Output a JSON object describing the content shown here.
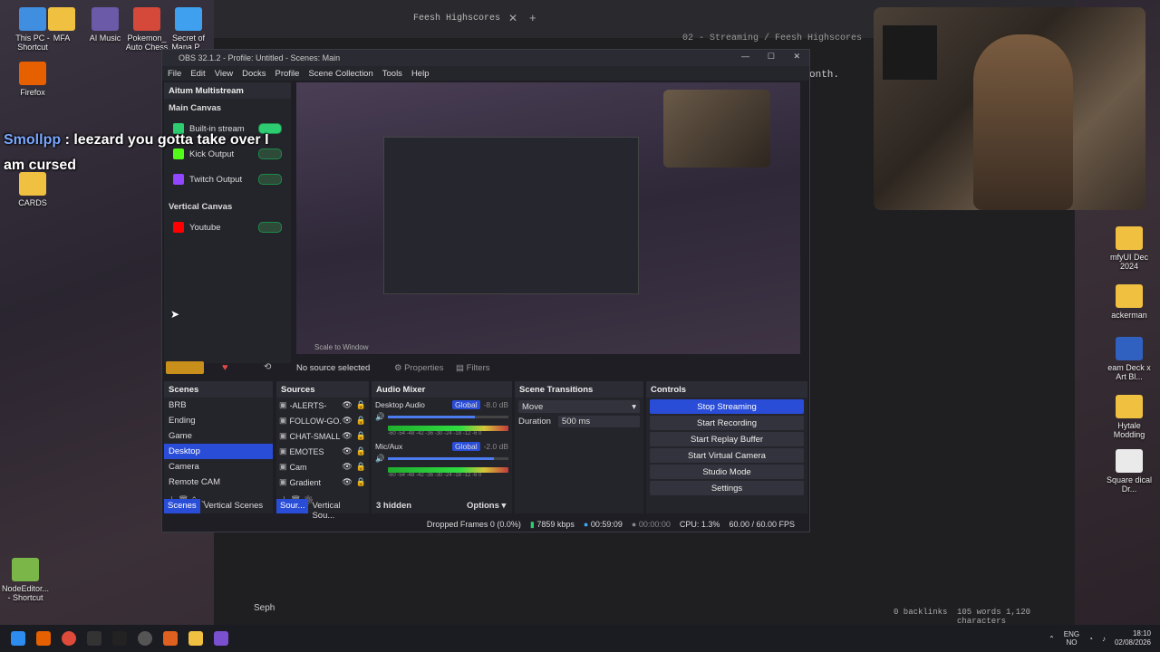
{
  "desktop": {
    "icons": [
      {
        "label": "This PC - Shortcut"
      },
      {
        "label": "MFA"
      },
      {
        "label": "AI Music"
      },
      {
        "label": "Pokemon_ Auto Chess"
      },
      {
        "label": "Secret of Mana P..."
      },
      {
        "label": "Firefox"
      },
      {
        "label": "CARDS"
      },
      {
        "label": "NodeEditor... - Shortcut"
      },
      {
        "label": "mfyUI Dec 2024"
      },
      {
        "label": "ackerman"
      },
      {
        "label": "eam Deck x Art Bl..."
      },
      {
        "label": "Hytale Modding"
      },
      {
        "label": "Square dical Dr..."
      }
    ]
  },
  "bg_editor": {
    "tab_title": "Feesh Highscores",
    "breadcrumb": "02 - Streaming / Feesh Highscores",
    "text_fragment": "onth.",
    "status_user": "Seph",
    "backlinks": "0 backlinks",
    "word_count": "105 words 1,120 characters"
  },
  "chat": {
    "user": "Smollpp",
    "message_line1": ": leezard you gotta take over I",
    "message_line2": "am cursed"
  },
  "obs": {
    "title": "OBS 32.1.2 - Profile: Untitled - Scenes: Main",
    "menu": [
      "File",
      "Edit",
      "View",
      "Docks",
      "Profile",
      "Scene Collection",
      "Tools",
      "Help"
    ],
    "multistream": {
      "title": "Aitum Multistream",
      "main_canvas": "Main Canvas",
      "vertical_canvas": "Vertical Canvas",
      "outputs_main": [
        {
          "label": "Built-in stream",
          "on": true,
          "color": "#2ecc71"
        },
        {
          "label": "Kick Output",
          "on": false,
          "color": "#53fc18"
        },
        {
          "label": "Twitch Output",
          "on": false,
          "color": "#9146ff"
        }
      ],
      "outputs_vertical": [
        {
          "label": "Youtube",
          "on": false,
          "color": "#ff0000"
        }
      ]
    },
    "no_source": "No source selected",
    "properties": "Properties",
    "filters": "Filters",
    "scenes": {
      "title": "Scenes",
      "items": [
        "BRB",
        "Ending",
        "Game",
        "Desktop",
        "Camera",
        "Remote CAM"
      ],
      "selected": "Desktop",
      "tab1": "Scenes",
      "tab2": "Vertical Scenes"
    },
    "sources": {
      "title": "Sources",
      "items": [
        "-ALERTS-",
        "FOLLOW-GO...",
        "CHAT-SMALL",
        "EMOTES",
        "Cam",
        "Gradient"
      ],
      "tab1": "Sour...",
      "tab2": "Vertical Sou..."
    },
    "audio": {
      "title": "Audio Mixer",
      "channels": [
        {
          "name": "Desktop Audio",
          "db": "-8.0 dB",
          "badge": "Global",
          "level": 0.72
        },
        {
          "name": "Mic/Aux",
          "db": "-2.0 dB",
          "badge": "Global",
          "level": 0.88
        }
      ],
      "ticks": "-60 -54 -48 -42 -36 -30 -24 -18 -12 -6 0",
      "hidden": "3 hidden",
      "options": "Options"
    },
    "transitions": {
      "title": "Scene Transitions",
      "type": "Move",
      "duration_label": "Duration",
      "duration": "500 ms"
    },
    "controls": {
      "title": "Controls",
      "buttons": [
        "Stop Streaming",
        "Start Recording",
        "Start Replay Buffer",
        "Start Virtual Camera",
        "Studio Mode",
        "Settings"
      ]
    },
    "status": {
      "dropped": "Dropped Frames 0 (0.0%)",
      "bitrate": "7859 kbps",
      "stream_time": "00:59:09",
      "rec_time": "00:00:00",
      "cpu": "CPU: 1.3%",
      "fps": "60.00 / 60.00 FPS"
    },
    "preview_zoom": "Scale to Window"
  },
  "taskbar": {
    "lang": "ENG",
    "region": "NO",
    "time": "18:10",
    "date": "02/08/2026"
  }
}
